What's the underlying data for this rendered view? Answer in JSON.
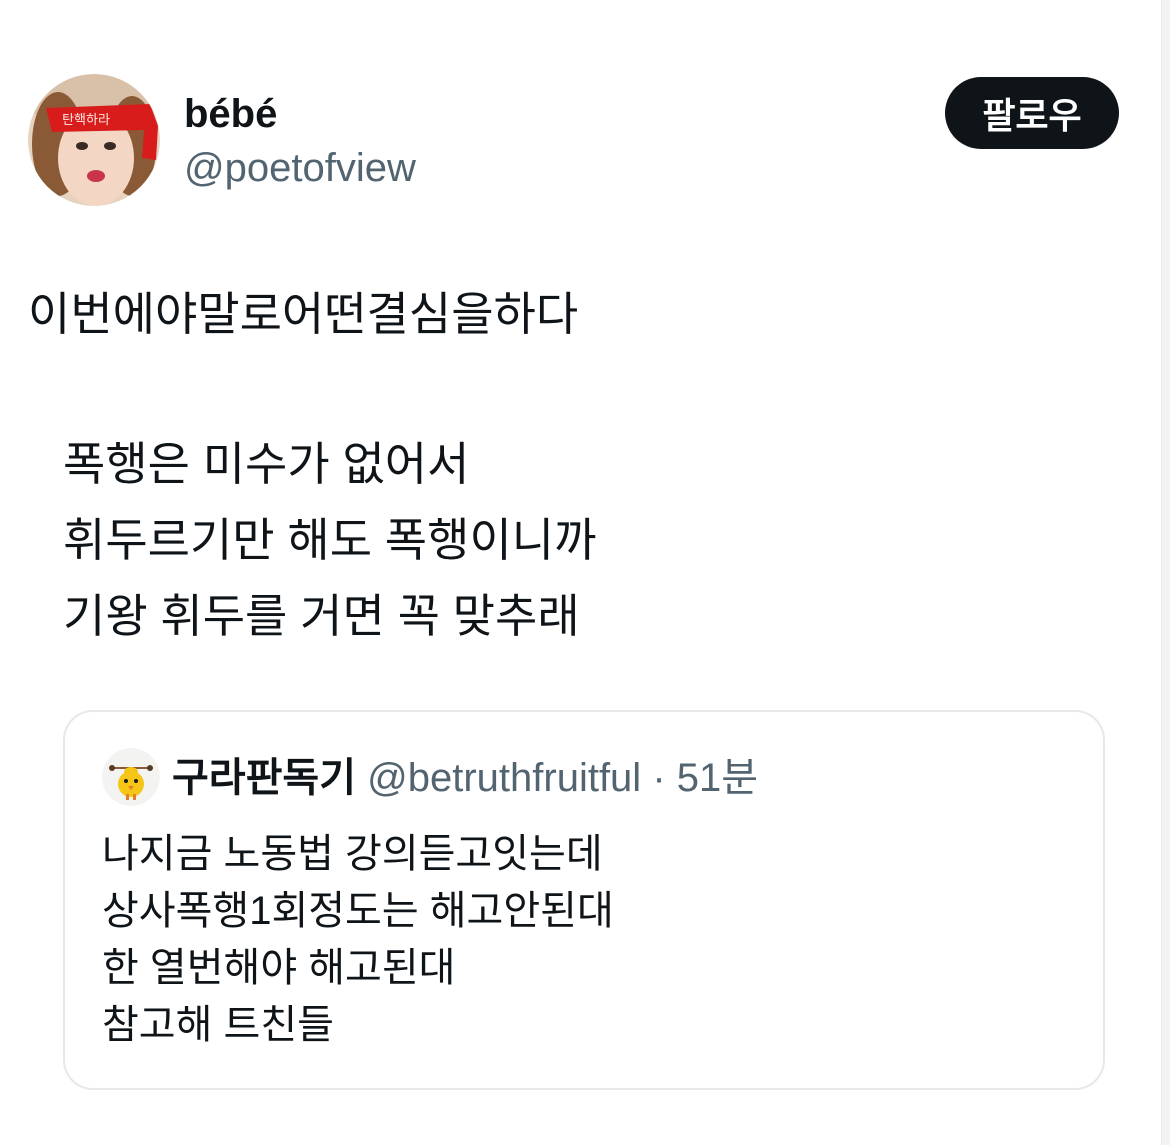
{
  "author": {
    "display_name": "bébé",
    "handle": "@poetofview",
    "avatar_icon": "profile-photo-red-headband-avatar",
    "avatar_headband_text": "탄핵하라"
  },
  "follow_button": {
    "label": "팔로우",
    "background": "#0f1419",
    "text_color": "#ffffff"
  },
  "tweet": {
    "lead": "이번에야말로어떤결심을하다",
    "lines": [
      "폭행은 미수가 없어서",
      "휘두르기만 해도 폭행이니까",
      "기왕 휘두를 거면 꼭 맞추래"
    ]
  },
  "quoted_tweet": {
    "avatar_icon": "yellow-chick-avatar",
    "display_name": "구라판독기",
    "handle": "@betruthfruitful",
    "separator": "·",
    "time": "51분",
    "lines": [
      "나지금 노동법 강의듣고잇는데",
      "상사폭행1회정도는 해고안된대",
      "한 열번해야 해고된대",
      "참고해 트친들"
    ]
  },
  "colors": {
    "text_primary": "#0f1419",
    "text_secondary": "#536471",
    "card_border": "#e6e9ec",
    "background": "#ffffff"
  }
}
